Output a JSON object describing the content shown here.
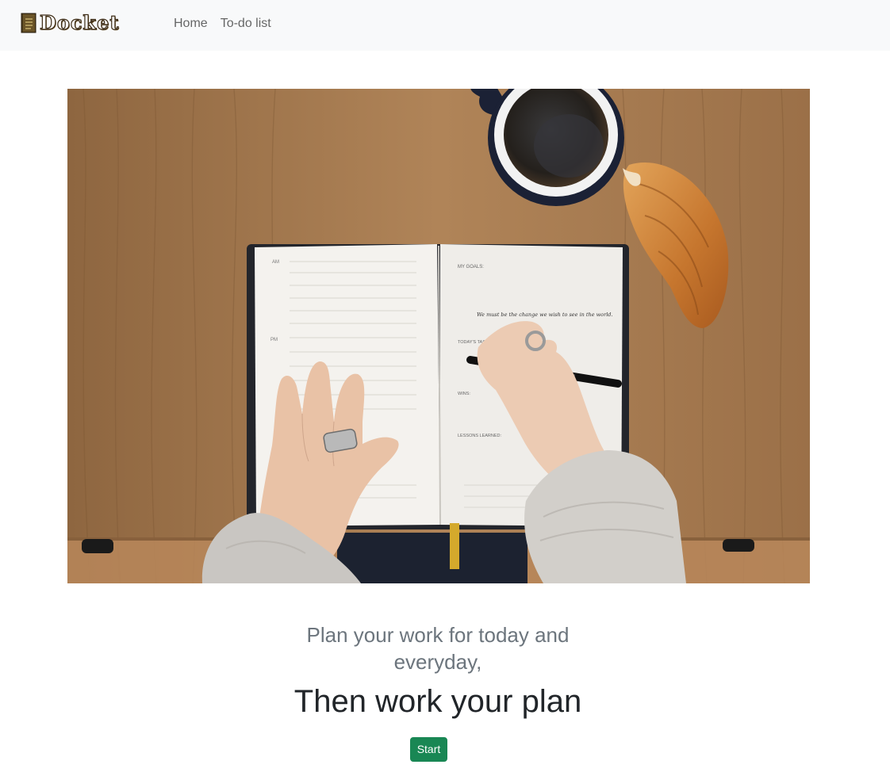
{
  "navbar": {
    "brand_text": "Docket",
    "brand_icon": "notebook-icon",
    "links": [
      {
        "label": "Home"
      },
      {
        "label": "To-do list"
      }
    ]
  },
  "hero": {
    "image_subject": "desk-planner-photo",
    "notebook_text": {
      "my_goals": "MY GOALS:",
      "quote": "We must be the change we wish to see in the world.",
      "todays_tasks": "TODAY'S TASKS:",
      "wins": "WINS:",
      "lessons_learned": "LESSONS LEARNED:",
      "am_label": "AM",
      "pm_label": "PM"
    }
  },
  "tagline": {
    "subtitle": "Plan your work for today and everyday,",
    "headline": "Then work your plan"
  },
  "actions": {
    "start_label": "Start"
  },
  "colors": {
    "navbar_bg": "#f8f9fa",
    "button_green": "#198754",
    "subtitle_gray": "#6c757d",
    "wood": "#a87c52"
  }
}
